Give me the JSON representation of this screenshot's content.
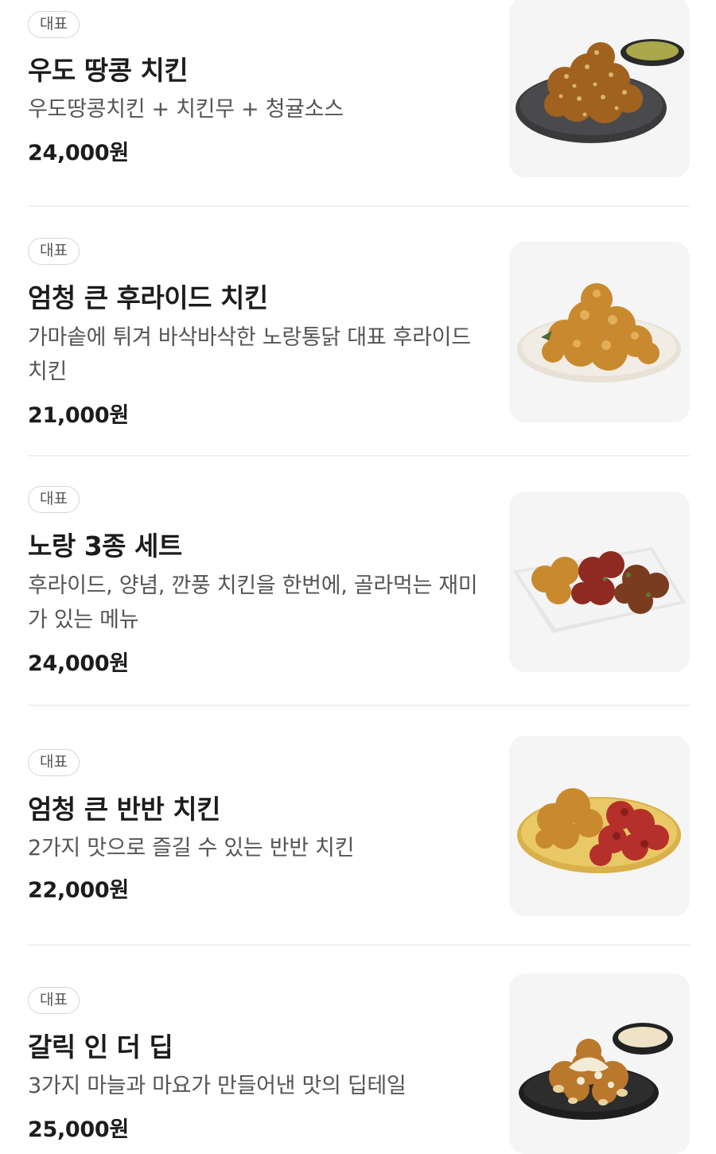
{
  "menu_items": [
    {
      "badge": "대표",
      "name": "우도 땅콩 치킨",
      "description": "우도땅콩치킨 + 치킨무 + 청귤소스",
      "price": "24,000원",
      "image": "peanut-chicken-with-sauce-photo"
    },
    {
      "badge": "대표",
      "name": "엄청 큰 후라이드 치킨",
      "description": "가마솥에 튀겨 바삭바삭한 노랑통닭 대표 후라이드 치킨",
      "price": "21,000원",
      "image": "fried-chicken-plate-photo"
    },
    {
      "badge": "대표",
      "name": "노랑 3종 세트",
      "description": "후라이드, 양념, 깐풍 치킨을 한번에, 골라먹는 재미가 있는 메뉴",
      "price": "24,000원",
      "image": "three-kind-chicken-set-photo"
    },
    {
      "badge": "대표",
      "name": "엄청 큰 반반 치킨",
      "description": "2가지 맛으로 즐길 수 있는 반반 치킨",
      "price": "22,000원",
      "image": "half-half-chicken-photo"
    },
    {
      "badge": "대표",
      "name": "갈릭 인 더 딥",
      "description": "3가지 마늘과 마요가 만들어낸 맛의 딥테일",
      "price": "25,000원",
      "image": "garlic-dip-chicken-photo"
    }
  ]
}
